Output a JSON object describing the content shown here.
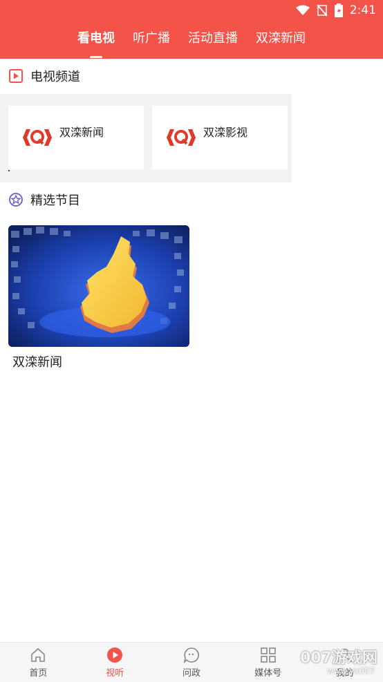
{
  "status": {
    "time": "2:41"
  },
  "tabs": [
    {
      "label": "看电视"
    },
    {
      "label": "听广播"
    },
    {
      "label": "活动直播"
    },
    {
      "label": "双滦新闻"
    }
  ],
  "sections": {
    "tv_channels": {
      "title": "电视频道"
    },
    "featured": {
      "title": "精选节目"
    }
  },
  "channels": [
    {
      "name": "双滦新闻"
    },
    {
      "name": "双滦影视"
    }
  ],
  "programs": [
    {
      "title": "双滦新闻"
    }
  ],
  "bottom_nav": [
    {
      "label": "首页"
    },
    {
      "label": "视听"
    },
    {
      "label": "问政"
    },
    {
      "label": "媒体号"
    },
    {
      "label": "我的"
    }
  ],
  "watermark": {
    "text": "007游戏网",
    "url_text": "www.yx007"
  },
  "colors": {
    "accent": "#f4534a",
    "header_bg": "#f4534a"
  }
}
